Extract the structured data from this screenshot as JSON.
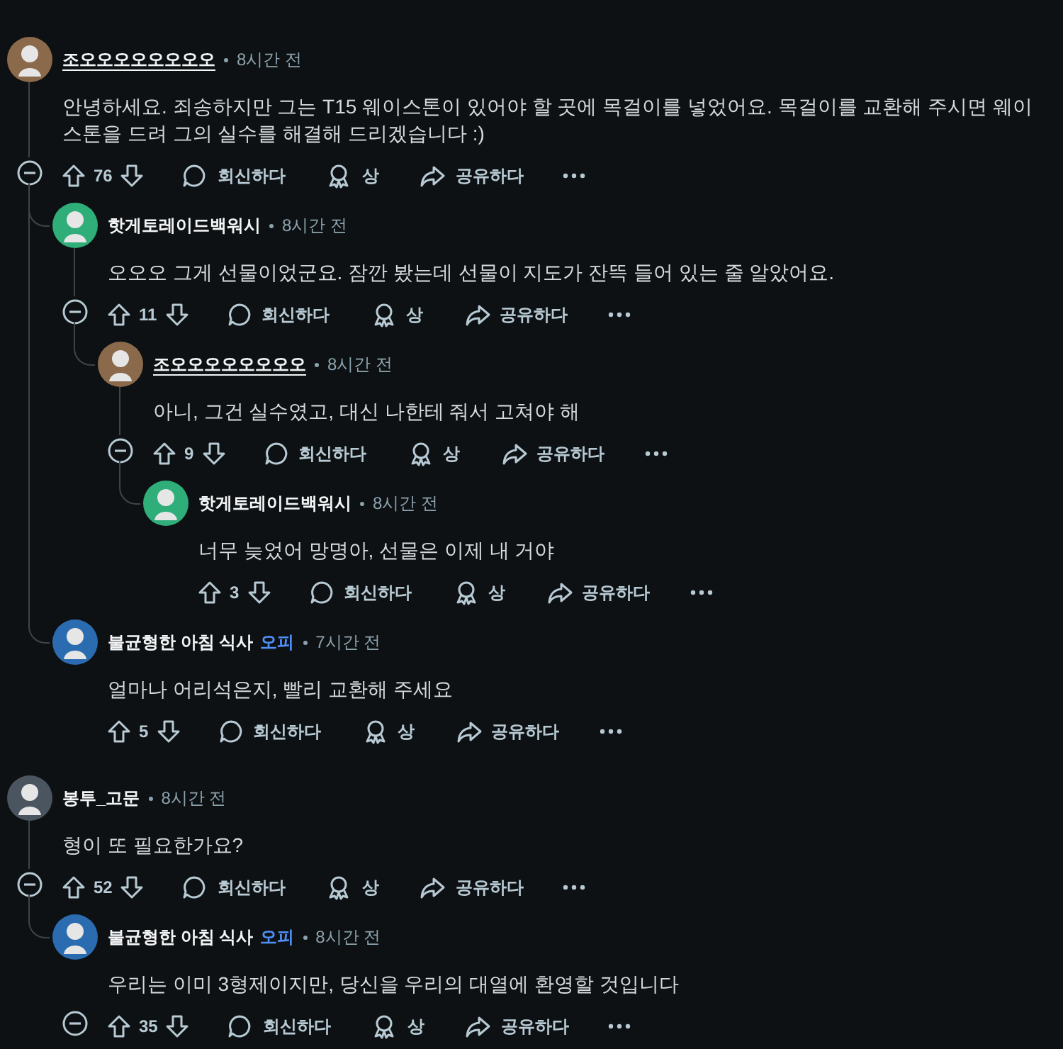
{
  "comments": [
    {
      "author": "조오오오오오오오오",
      "underlined": true,
      "time": "8시간 전",
      "color": "#8a6a4a",
      "body": "안녕하세요. 죄송하지만 그는 T15 웨이스톤이 있어야 할 곳에 목걸이를 넣었어요. 목걸이를 교환해 주시면 웨이스톤을 드려 그의 실수를 해결해 드리겠습니다 :)",
      "expanded": true,
      "actions": {
        "score": "76",
        "reply": "회신하다",
        "award": "상",
        "share": "공유하다"
      },
      "children": [
        {
          "author": "핫게토레이드백워시",
          "underlined": false,
          "time": "8시간 전",
          "color": "#2fae7a",
          "body": "오오오 그게 선물이었군요. 잠깐 봤는데 선물이 지도가 잔뜩 들어 있는 줄 알았어요.",
          "expanded": true,
          "actions": {
            "score": "11",
            "reply": "회신하다",
            "award": "상",
            "share": "공유하다"
          },
          "children": [
            {
              "author": "조오오오오오오오오",
              "underlined": true,
              "time": "8시간 전",
              "color": "#8a6a4a",
              "body": "아니, 그건 실수였고, 대신 나한테 줘서 고쳐야 해",
              "expanded": true,
              "actions": {
                "score": "9",
                "reply": "회신하다",
                "award": "상",
                "share": "공유하다"
              },
              "children": [
                {
                  "author": "핫게토레이드백워시",
                  "underlined": false,
                  "time": "8시간 전",
                  "color": "#2fae7a",
                  "body": "너무 늦었어 망명아, 선물은 이제 내 거야",
                  "actions": {
                    "score": "3",
                    "reply": "회신하다",
                    "award": "상",
                    "share": "공유하다"
                  }
                }
              ]
            }
          ]
        },
        {
          "author": "불균형한 아침 식사",
          "underlined": false,
          "op_badge": "오피",
          "time": "7시간 전",
          "color": "#2b6cb0",
          "body": "얼마나 어리석은지, 빨리 교환해 주세요",
          "actions": {
            "score": "5",
            "reply": "회신하다",
            "award": "상",
            "share": "공유하다"
          }
        }
      ]
    },
    {
      "author": "봉투_고문",
      "underlined": false,
      "time": "8시간 전",
      "color": "#4a5560",
      "body": "형이 또 필요한가요?",
      "expanded": true,
      "actions": {
        "score": "52",
        "reply": "회신하다",
        "award": "상",
        "share": "공유하다"
      },
      "children": [
        {
          "author": "불균형한 아침 식사",
          "underlined": false,
          "op_badge": "오피",
          "time": "8시간 전",
          "color": "#2b6cb0",
          "body": "우리는 이미 3형제이지만, 당신을 우리의 대열에 환영할 것입니다",
          "expanded": true,
          "actions": {
            "score": "35",
            "reply": "회신하다",
            "award": "상",
            "share": "공유하다"
          }
        }
      ]
    }
  ]
}
